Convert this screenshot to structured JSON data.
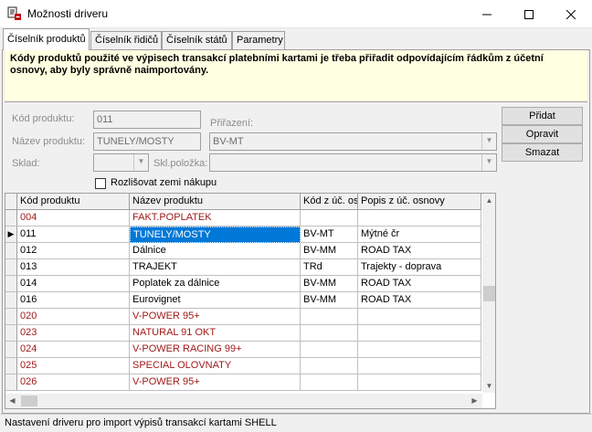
{
  "window": {
    "title": "Možnosti driveru",
    "minimize_glyph": "—",
    "maximize_glyph": "☐",
    "close_glyph": "✕"
  },
  "tabs": [
    {
      "label": "Číselník produktů",
      "active": true
    },
    {
      "label": "Číselník řidičů",
      "active": false
    },
    {
      "label": "Číselník států",
      "active": false
    },
    {
      "label": "Parametry",
      "active": false
    }
  ],
  "info": {
    "text": "Kódy produktů použité ve výpisech transakcí platebními kartami je třeba přiřadit odpovídajícím řádkům z účetní osnovy, aby byly správně naimportovány."
  },
  "form": {
    "kod_label": "Kód produktu:",
    "kod_value": "011",
    "nazev_label": "Název produktu:",
    "nazev_value": "TUNELY/MOSTY",
    "prirazeni_label": "Přiřazení:",
    "prirazeni_value": "BV-MT",
    "sklad_label": "Sklad:",
    "sklad_value": "",
    "sklpolozka_label": "Skl.položka:",
    "sklpolozka_value": "",
    "checkbox_label": "Rozlišovat zemi nákupu"
  },
  "buttons": {
    "pridat": "Přidat",
    "opravit": "Opravit",
    "smazat": "Smazat"
  },
  "grid": {
    "headers": [
      "Kód produktu",
      "Název produktu",
      "Kód z úč. os",
      "Popis z úč. osnovy"
    ],
    "rows": [
      {
        "kod": "004",
        "nazev": "FAKT.POPLATEK",
        "uc": "",
        "popis": "",
        "red": true
      },
      {
        "kod": "011",
        "nazev": "TUNELY/MOSTY",
        "uc": "BV-MT",
        "popis": "Mýtné čr",
        "red": false,
        "current": true
      },
      {
        "kod": "012",
        "nazev": "Dálnice",
        "uc": "BV-MM",
        "popis": "ROAD TAX",
        "red": false
      },
      {
        "kod": "013",
        "nazev": "TRAJEKT",
        "uc": "TRd",
        "popis": "Trajekty - doprava",
        "red": false
      },
      {
        "kod": "014",
        "nazev": "Poplatek za dálnice",
        "uc": "BV-MM",
        "popis": "ROAD TAX",
        "red": false
      },
      {
        "kod": "016",
        "nazev": "Eurovignet",
        "uc": "BV-MM",
        "popis": "ROAD TAX",
        "red": false
      },
      {
        "kod": "020",
        "nazev": "V-POWER 95+",
        "uc": "",
        "popis": "",
        "red": true
      },
      {
        "kod": "023",
        "nazev": "NATURAL 91 OKT",
        "uc": "",
        "popis": "",
        "red": true
      },
      {
        "kod": "024",
        "nazev": "V-POWER RACING 99+",
        "uc": "",
        "popis": "",
        "red": true
      },
      {
        "kod": "025",
        "nazev": "SPECIAL OLOVNATY",
        "uc": "",
        "popis": "",
        "red": true
      },
      {
        "kod": "026",
        "nazev": "V-POWER 95+",
        "uc": "",
        "popis": "",
        "red": true
      }
    ]
  },
  "statusbar": {
    "text": "Nastavení driveru pro import výpisů transakcí kartami SHELL"
  },
  "colors": {
    "accent": "#0078d7",
    "missing_row": "#a01a1a",
    "info_bg": "#ffffe1"
  }
}
